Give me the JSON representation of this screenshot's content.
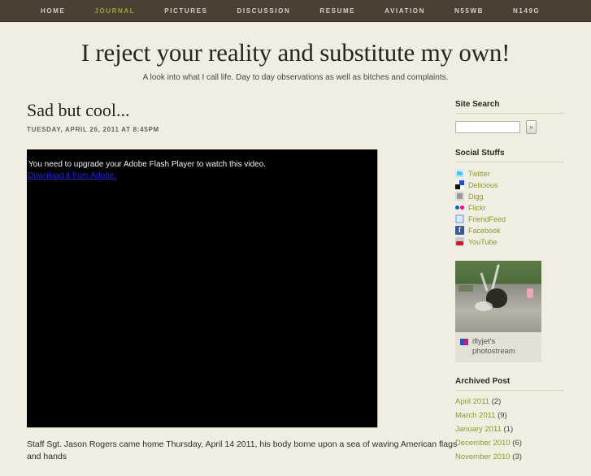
{
  "nav": {
    "items": [
      {
        "label": "HOME",
        "active": false
      },
      {
        "label": "JOURNAL",
        "active": true
      },
      {
        "label": "PICTURES",
        "active": false
      },
      {
        "label": "DISCUSSION",
        "active": false
      },
      {
        "label": "RESUME",
        "active": false
      },
      {
        "label": "AVIATION",
        "active": false
      },
      {
        "label": "N55WB",
        "active": false
      },
      {
        "label": "N149G",
        "active": false
      }
    ]
  },
  "header": {
    "title": "I reject your reality and substitute my own!",
    "tagline": "A look into what I call life. Day to day observations as well as bitches and complaints."
  },
  "post": {
    "title": "Sad but cool...",
    "date": "TUESDAY, APRIL 26, 2011 AT 8:45PM",
    "video": {
      "message": "You need to upgrade your Adobe Flash Player to watch this video.",
      "link_label": "Download it from Adobe."
    },
    "body": "Staff Sgt. Jason Rogers came home Thursday, April 14 2011, his body borne upon a sea of waving American flags and hands"
  },
  "sidebar": {
    "site_search": {
      "heading": "Site Search",
      "value": "",
      "placeholder": "",
      "button_label": "»"
    },
    "social": {
      "heading": "Social Stuffs",
      "items": [
        {
          "label": "Twitter",
          "icon": "twitter-icon"
        },
        {
          "label": "Delicious",
          "icon": "delicious-icon"
        },
        {
          "label": "Digg",
          "icon": "digg-icon"
        },
        {
          "label": "Flickr",
          "icon": "flickr-icon"
        },
        {
          "label": "FriendFeed",
          "icon": "friendfeed-icon"
        },
        {
          "label": "Facebook",
          "icon": "facebook-icon"
        },
        {
          "label": "YouTube",
          "icon": "youtube-icon"
        }
      ]
    },
    "flickr": {
      "caption": "iflyjet's photostream"
    },
    "archive": {
      "heading": "Archived Post",
      "items": [
        {
          "label": "April 2011",
          "count": "(2)"
        },
        {
          "label": "March 2011",
          "count": "(9)"
        },
        {
          "label": "January 2011",
          "count": "(1)"
        },
        {
          "label": "December 2010",
          "count": "(6)"
        },
        {
          "label": "November 2010",
          "count": "(3)"
        }
      ]
    }
  },
  "colors": {
    "nav_bg": "#4a4034",
    "page_bg": "#efeee1",
    "accent_green": "#8d9b2e",
    "link_blue": "#2222dd"
  }
}
